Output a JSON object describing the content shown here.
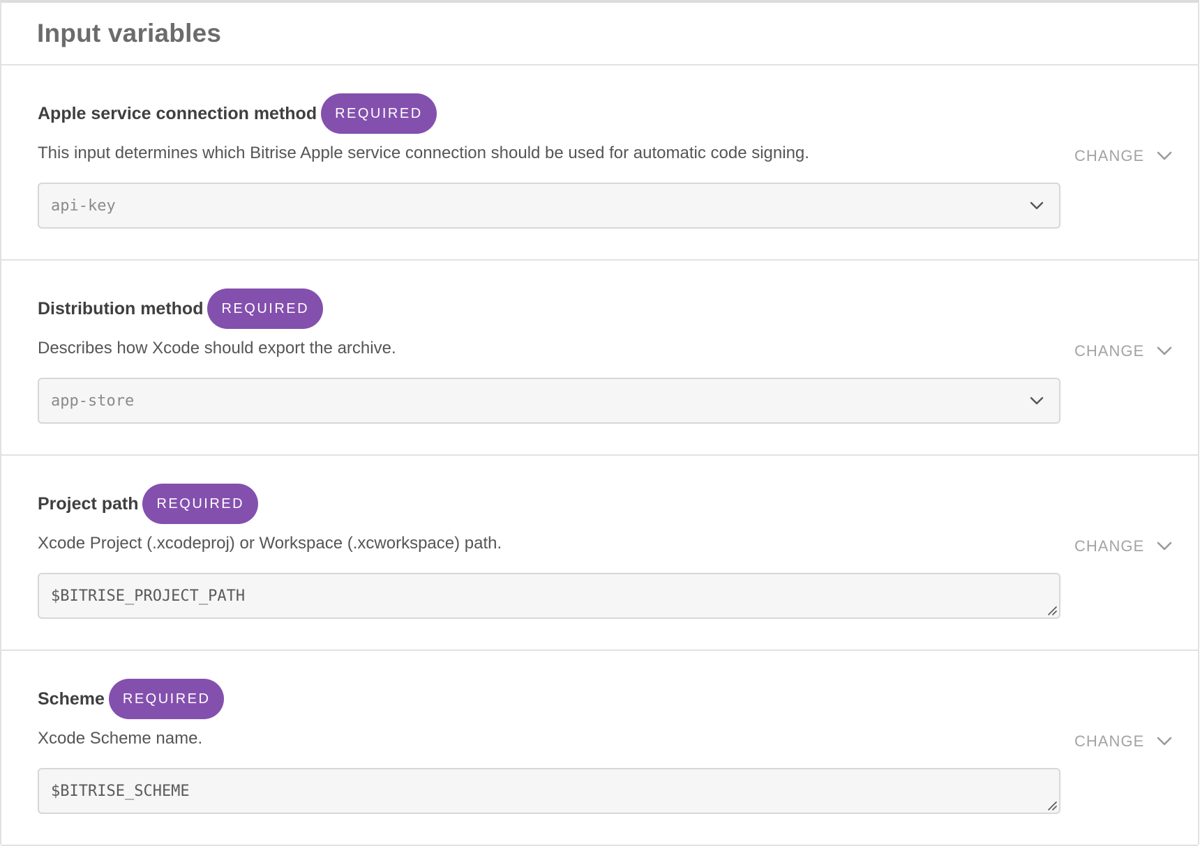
{
  "panel": {
    "title": "Input variables"
  },
  "inputs": [
    {
      "label": "Apple service connection method",
      "badge": "REQUIRED",
      "description": "This input determines which Bitrise Apple service connection should be used for automatic code signing.",
      "kind": "select",
      "value": "api-key",
      "change_label": "CHANGE"
    },
    {
      "label": "Distribution method",
      "badge": "REQUIRED",
      "description": "Describes how Xcode should export the archive.",
      "kind": "select",
      "value": "app-store",
      "change_label": "CHANGE"
    },
    {
      "label": "Project path",
      "badge": "REQUIRED",
      "description": "Xcode Project (.xcodeproj) or Workspace (.xcworkspace) path.",
      "kind": "textarea",
      "value": "$BITRISE_PROJECT_PATH",
      "change_label": "CHANGE"
    },
    {
      "label": "Scheme",
      "badge": "REQUIRED",
      "description": "Xcode Scheme name.",
      "kind": "textarea",
      "value": "$BITRISE_SCHEME",
      "change_label": "CHANGE"
    }
  ],
  "colors": {
    "badge_background": "#8450ae",
    "badge_text": "#ffffff",
    "change_text": "#a3a3a3",
    "field_background": "#f6f6f6",
    "border": "#e2e2e2"
  },
  "icons": {
    "select_chevron": "chevron-down-icon",
    "change_chevron": "chevron-down-icon",
    "resize": "resize-handle-icon"
  }
}
